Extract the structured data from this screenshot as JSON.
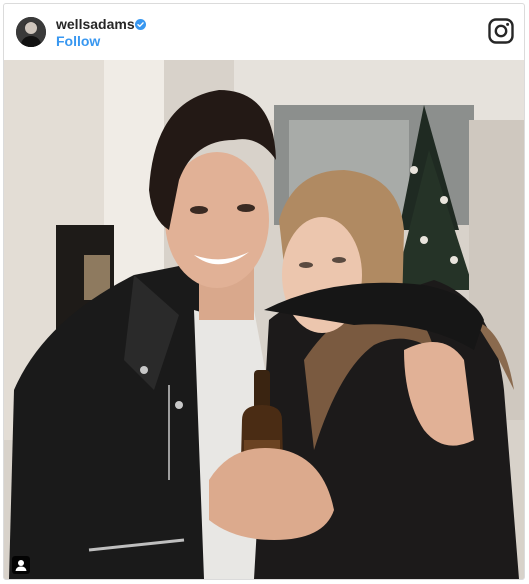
{
  "post": {
    "username": "wellsadams",
    "follow_label": "Follow",
    "verified": true
  },
  "icons": {
    "verified": "verified-badge-icon",
    "brand": "instagram-icon",
    "tag": "user-tag-icon"
  },
  "colors": {
    "follow": "#3897f0",
    "verified": "#3897f0",
    "username": "#262626",
    "border": "#dbdbdb"
  }
}
